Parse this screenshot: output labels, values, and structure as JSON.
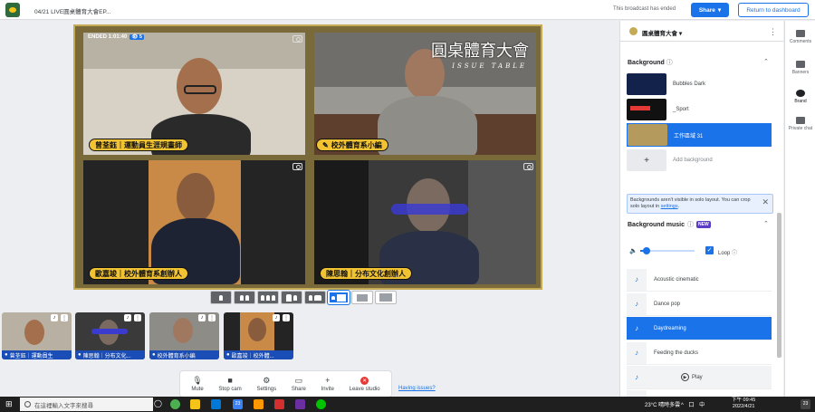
{
  "header": {
    "title": "04/21 LIVE圓桌體育大會EP...",
    "status": "This broadcast has ended",
    "share_label": "Share",
    "return_label": "Return to dashboard"
  },
  "stage": {
    "ended_label": "ENDED 1:01:40",
    "viewers": "5",
    "overlay_title": "圓桌體育大會",
    "overlay_subtitle": "ISSUE TABLE",
    "tiles": [
      {
        "name": "曾荃鈺｜運動員生涯規畫師"
      },
      {
        "name": "校外體育系小編"
      },
      {
        "name": "歐嘉竣｜校外體育系創辦人"
      },
      {
        "name": "陳思翰｜分布文化創辦人"
      }
    ]
  },
  "thumbnails": [
    {
      "label": "曾荃鈺｜運動員生"
    },
    {
      "label": "陳思翰｜分布文化..."
    },
    {
      "label": "校外體育系小編"
    },
    {
      "label": "歐嘉竣｜校外體..."
    }
  ],
  "controls": {
    "mute": "Mute",
    "stop_cam": "Stop cam",
    "settings": "Settings",
    "share": "Share",
    "invite": "Invite",
    "leave": "Leave studio",
    "issues": "Having issues?"
  },
  "panel": {
    "brand_name": "圓桌體育大會",
    "background_heading": "Background",
    "backgrounds": [
      {
        "label": "Bubbles Dark",
        "selected": false
      },
      {
        "label": "_Sport",
        "selected": false
      },
      {
        "label": "工作區域 31",
        "selected": true
      }
    ],
    "add_background": "Add background",
    "notice_text": "Backgrounds aren't visible in solo layout. You can crop solo layout in ",
    "notice_link": "settings",
    "music_heading": "Background music",
    "new_badge": "NEW",
    "loop_label": "Loop",
    "tracks": [
      {
        "label": "Acoustic cinematic",
        "selected": false
      },
      {
        "label": "Dance pop",
        "selected": false
      },
      {
        "label": "Daydreaming",
        "selected": true
      },
      {
        "label": "Feeding the ducks",
        "selected": false
      }
    ],
    "play_label": "Play"
  },
  "rail": {
    "comments": "Comments",
    "banners": "Banners",
    "brand": "Brand",
    "private_chat": "Private chat"
  },
  "taskbar": {
    "search_placeholder": "在這裡輸入文字來搜尋",
    "weather": "23°C 晴時多雲",
    "tray": "^ 口 中",
    "time": "下午 09:45",
    "date": "2022/4/21",
    "badge": "23"
  },
  "colors": {
    "accent": "#1a73e8",
    "lower_third": "#f1c232",
    "stage_border": "#c5ab55"
  }
}
